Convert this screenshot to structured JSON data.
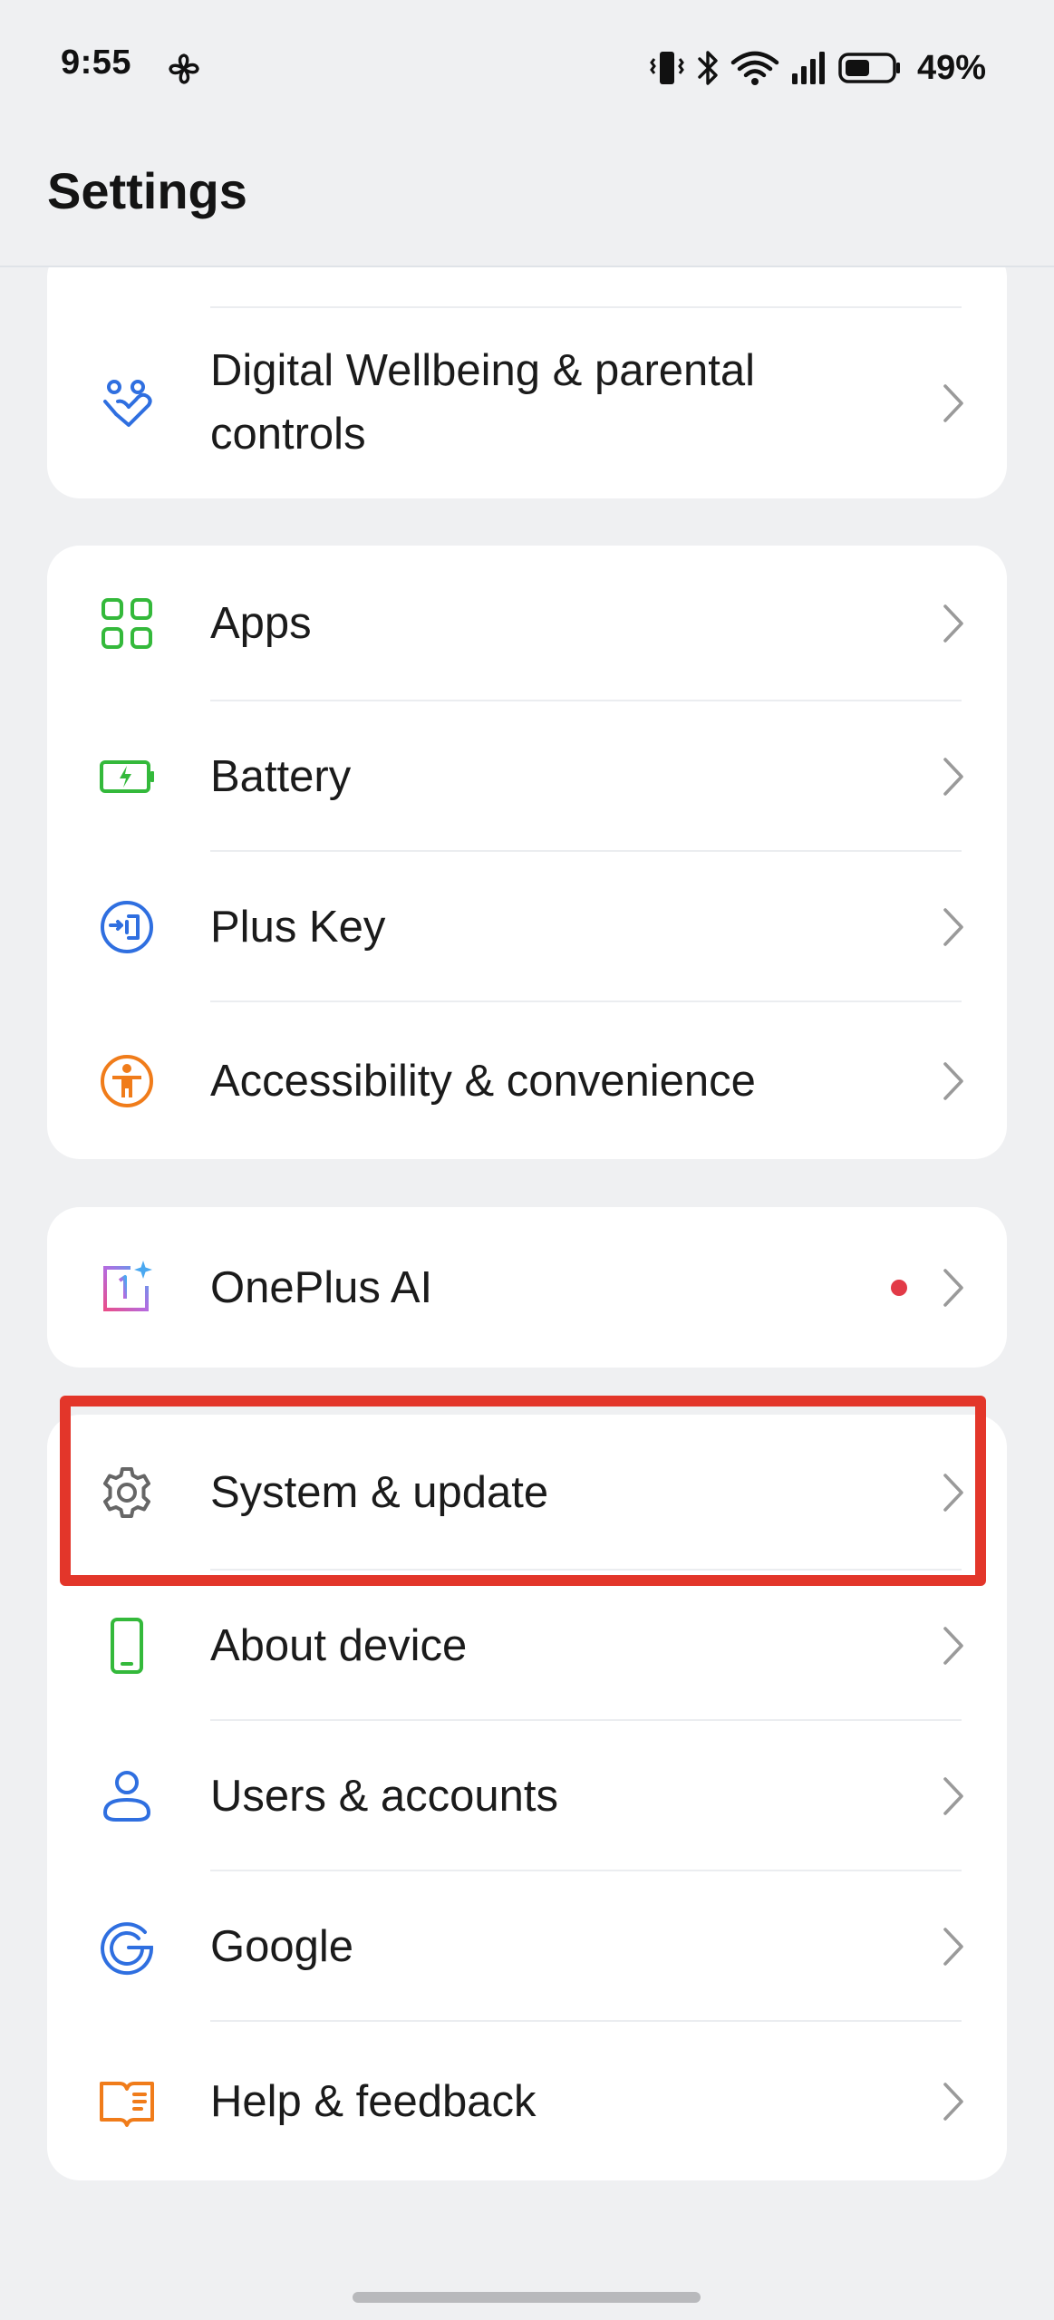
{
  "status_bar": {
    "time": "9:55",
    "battery_percent": "49%",
    "icons": [
      "fan-icon",
      "vibrate-icon",
      "bluetooth-icon",
      "wifi-icon",
      "signal-icon",
      "battery-icon"
    ]
  },
  "app_bar": {
    "title": "Settings"
  },
  "groups": [
    {
      "items": [
        {
          "label_line1": "Digital Wellbeing & parental",
          "label_line2": "controls",
          "icon": "digital-wellbeing-icon"
        }
      ]
    },
    {
      "items": [
        {
          "label": "Apps",
          "icon": "apps-grid-icon"
        },
        {
          "label": "Battery",
          "icon": "battery-charging-icon"
        },
        {
          "label": "Plus Key",
          "icon": "plus-key-icon"
        },
        {
          "label": "Accessibility & convenience",
          "icon": "accessibility-icon"
        }
      ]
    },
    {
      "items": [
        {
          "label": "OnePlus AI",
          "icon": "oneplus-ai-icon",
          "has_notification_dot": true
        }
      ]
    },
    {
      "items": [
        {
          "label": "System & update",
          "icon": "gear-icon",
          "highlighted": true
        },
        {
          "label": "About device",
          "icon": "phone-icon"
        },
        {
          "label": "Users & accounts",
          "icon": "user-icon"
        },
        {
          "label": "Google",
          "icon": "google-icon"
        },
        {
          "label": "Help & feedback",
          "icon": "help-book-icon"
        }
      ]
    }
  ],
  "colors": {
    "background": "#eff0f2",
    "card": "#ffffff",
    "highlight": "#e3362a",
    "notification_dot": "#e23a47",
    "icon_blue": "#2f6fe0",
    "icon_green": "#34b93b",
    "icon_orange": "#f07c1a"
  }
}
